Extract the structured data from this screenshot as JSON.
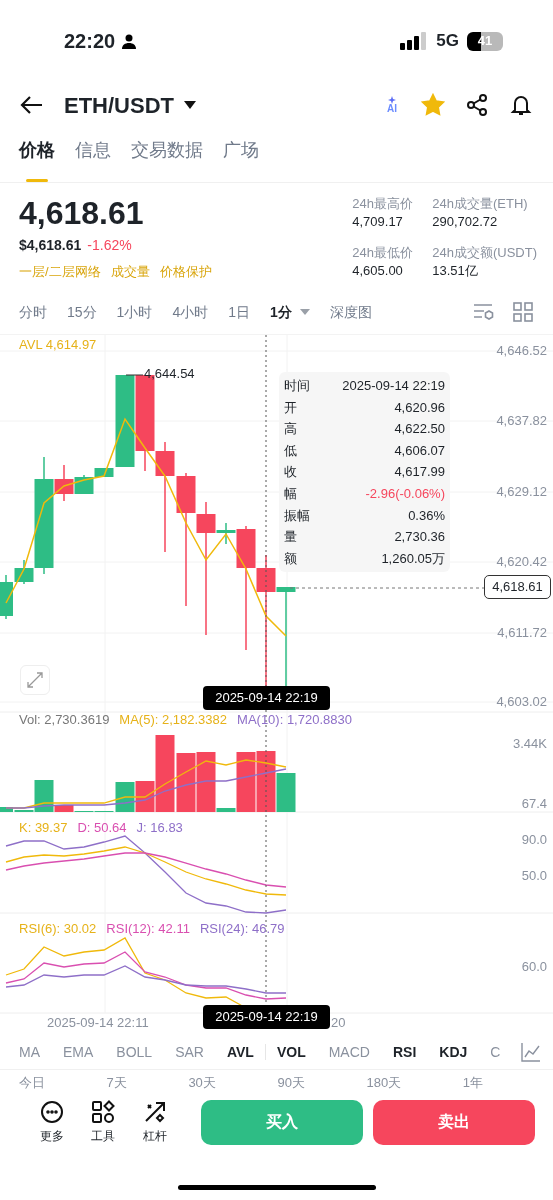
{
  "status_bar": {
    "time": "22:20",
    "network": "5G",
    "battery": "41"
  },
  "header": {
    "pair": "ETH/USDT",
    "ai_label": "AI",
    "favorite": true
  },
  "tabs": [
    {
      "label": "价格",
      "selected": true
    },
    {
      "label": "信息",
      "selected": false
    },
    {
      "label": "交易数据",
      "selected": false
    },
    {
      "label": "广场",
      "selected": false
    }
  ],
  "price": {
    "last": "4,618.61",
    "usd": "$4,618.61",
    "change": "-1.62%",
    "tags": [
      "一层/二层网络",
      "成交量",
      "价格保护"
    ]
  },
  "stats": [
    {
      "label": "24h最高价",
      "value": "4,709.17"
    },
    {
      "label": "24h成交量(ETH)",
      "value": "290,702.72"
    },
    {
      "label": "24h最低价",
      "value": "4,605.00"
    },
    {
      "label": "24h成交额(USDT)",
      "value": "13.51亿"
    }
  ],
  "intervals": [
    {
      "label": "分时",
      "selected": false
    },
    {
      "label": "15分",
      "selected": false
    },
    {
      "label": "1小时",
      "selected": false
    },
    {
      "label": "4小时",
      "selected": false
    },
    {
      "label": "1日",
      "selected": false
    },
    {
      "label": "1分",
      "selected": true
    },
    {
      "label": "深度图",
      "selected": false
    }
  ],
  "chart": {
    "avl_label": "AVL 4,614.97",
    "price_axis": [
      "4,646.52",
      "4,637.82",
      "4,629.12",
      "4,620.42",
      "4,611.72",
      "4,603.02"
    ],
    "high_marker": "4,644.54",
    "current_price": "4,618.61",
    "crosshair_time": "2025-09-14 22:19",
    "tooltip": [
      {
        "label": "时间",
        "value": "2025-09-14 22:19",
        "negative": false
      },
      {
        "label": "开",
        "value": "4,620.96",
        "negative": false
      },
      {
        "label": "高",
        "value": "4,622.50",
        "negative": false
      },
      {
        "label": "低",
        "value": "4,606.07",
        "negative": false
      },
      {
        "label": "收",
        "value": "4,617.99",
        "negative": false
      },
      {
        "label": "幅",
        "value": "-2.96(-0.06%)",
        "negative": true
      },
      {
        "label": "振幅",
        "value": "0.36%",
        "negative": false
      },
      {
        "label": "量",
        "value": "2,730.36",
        "negative": false
      },
      {
        "label": "额",
        "value": "1,260.05万",
        "negative": false
      }
    ]
  },
  "volume": {
    "legend": [
      {
        "text": "Vol: 2,730.3619",
        "color": "#777777"
      },
      {
        "text": "MA(5): 2,182.3382",
        "color": "#e6b219"
      },
      {
        "text": "MA(10): 1,720.8830",
        "color": "#8e6fc8"
      }
    ],
    "axis": [
      "3.44K",
      "67.4"
    ]
  },
  "kdj": {
    "legend": [
      {
        "text": "K: 39.37",
        "color": "#e6b219"
      },
      {
        "text": "D: 50.64",
        "color": "#d94fb0"
      },
      {
        "text": "J: 16.83",
        "color": "#8e6fc8"
      }
    ],
    "axis": [
      "90.0",
      "50.0"
    ]
  },
  "rsi": {
    "legend": [
      {
        "text": "RSI(6): 30.02",
        "color": "#e6b219"
      },
      {
        "text": "RSI(12): 42.11",
        "color": "#d94fb0"
      },
      {
        "text": "RSI(24): 46.79",
        "color": "#8e6fc8"
      }
    ],
    "axis": [
      "60.0"
    ]
  },
  "time_axis": {
    "labels": [
      "2025-09-14 22:11",
      "20"
    ],
    "crosshair_time": "2025-09-14 22:19"
  },
  "indicators": [
    {
      "label": "MA",
      "selected": false
    },
    {
      "label": "EMA",
      "selected": false
    },
    {
      "label": "BOLL",
      "selected": false
    },
    {
      "label": "SAR",
      "selected": false
    },
    {
      "label": "AVL",
      "selected": true
    },
    {
      "label": "VOL",
      "selected": true
    },
    {
      "label": "MACD",
      "selected": false
    },
    {
      "label": "RSI",
      "selected": true
    },
    {
      "label": "KDJ",
      "selected": true
    },
    {
      "label": "C",
      "selected": false
    }
  ],
  "periods": [
    "今日",
    "7天",
    "30天",
    "90天",
    "180天",
    "1年"
  ],
  "actions": [
    {
      "label": "更多",
      "kind": "more"
    },
    {
      "label": "工具",
      "kind": "tools"
    },
    {
      "label": "杠杆",
      "kind": "leverage"
    }
  ],
  "buy": "买入",
  "sell": "卖出"
}
